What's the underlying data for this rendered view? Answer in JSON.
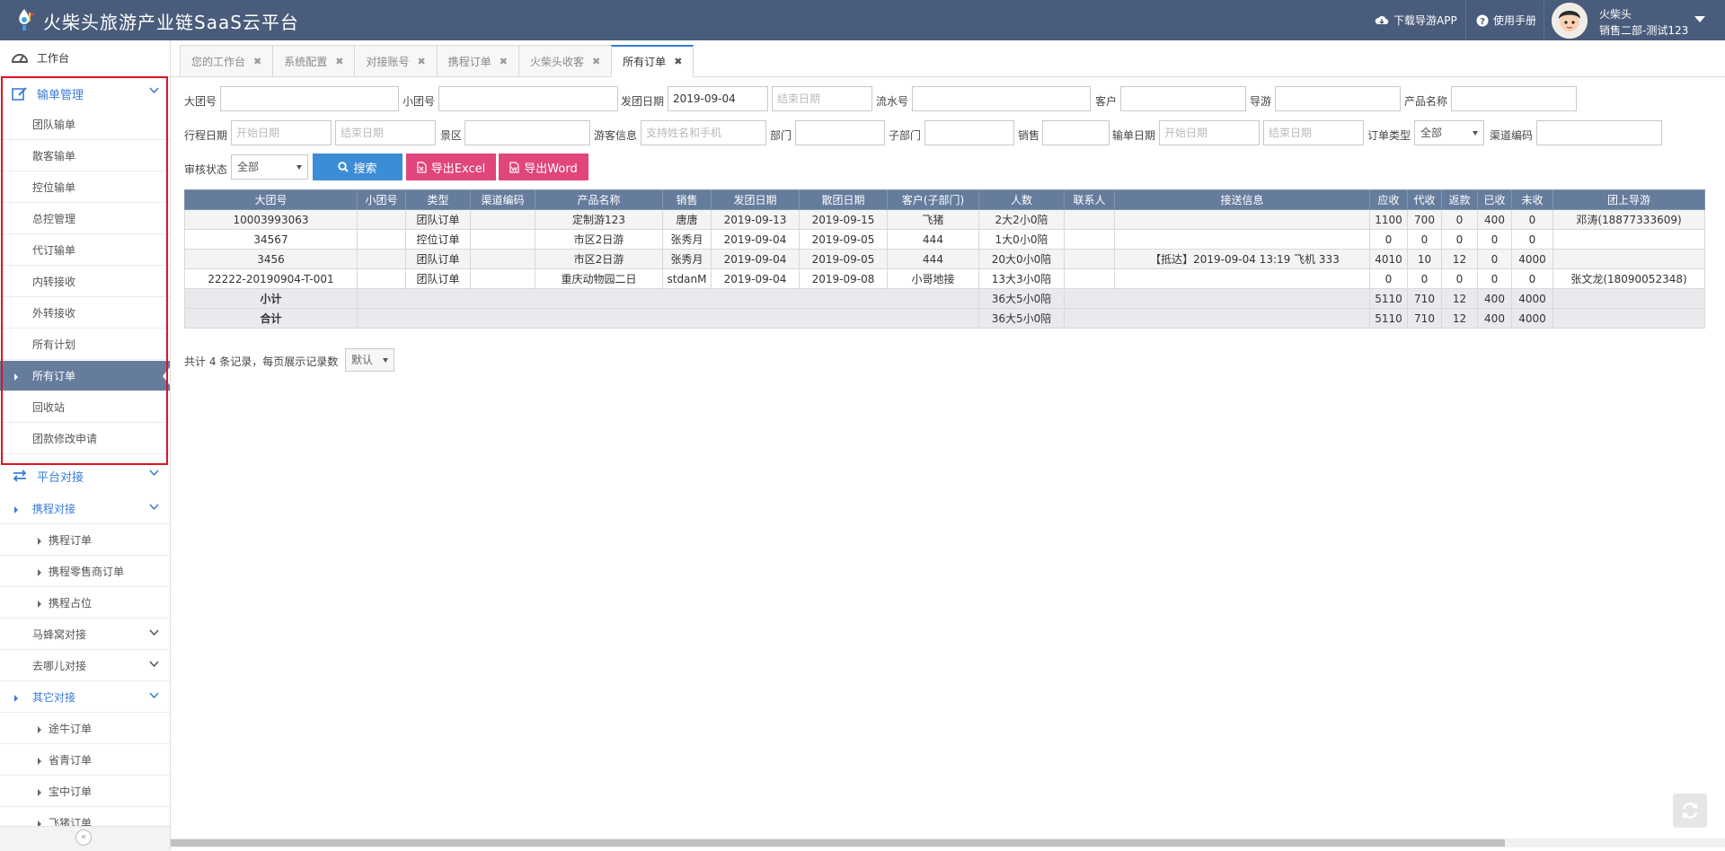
{
  "header": {
    "title": "火柴头旅游产业链SaaS云平台",
    "download_app": "下载导游APP",
    "manual": "使用手册",
    "user_name": "火柴头",
    "user_dept": "销售二部-测试123"
  },
  "sidebar": {
    "home": "工作台",
    "group1": "输单管理",
    "group1_items": [
      "团队输单",
      "散客输单",
      "控位输单",
      "总控管理",
      "代订输单",
      "内转接收",
      "外转接收",
      "所有计划",
      "所有订单",
      "回收站",
      "团款修改申请"
    ],
    "group2": "平台对接",
    "group2_items": [
      "携程对接",
      "携程订单",
      "携程零售商订单",
      "携程占位",
      "马蜂窝对接",
      "去哪儿对接",
      "其它对接",
      "途牛订单",
      "省青订单",
      "宝中订单",
      "飞猪订单"
    ]
  },
  "tabs": [
    {
      "label": "您的工作台"
    },
    {
      "label": "系统配置"
    },
    {
      "label": "对接账号"
    },
    {
      "label": "携程订单"
    },
    {
      "label": "火柴头收客"
    },
    {
      "label": "所有订单"
    }
  ],
  "filters": {
    "big_group": "大团号",
    "small_group": "小团号",
    "depart_date": "发团日期",
    "depart_date_value": "2019-09-04",
    "end_date_ph": "结束日期",
    "start_date_ph": "开始日期",
    "serial": "流水号",
    "customer": "客户",
    "guide": "导游",
    "product": "产品名称",
    "trip_date": "行程日期",
    "scenic": "景区",
    "tourist": "游客信息",
    "tourist_ph": "支持姓名和手机",
    "dept": "部门",
    "sub_dept": "子部门",
    "sales": "销售",
    "input_date": "输单日期",
    "order_type": "订单类型",
    "order_type_value": "全部",
    "channel": "渠道编码",
    "audit": "审核状态",
    "audit_value": "全部",
    "search_btn": "搜索",
    "excel_btn": "导出Excel",
    "word_btn": "导出Word"
  },
  "table": {
    "headers": [
      "大团号",
      "小团号",
      "类型",
      "渠道编码",
      "产品名称",
      "销售",
      "发团日期",
      "散团日期",
      "客户(子部门)",
      "人数",
      "联系人",
      "接送信息",
      "应收",
      "代收",
      "返款",
      "已收",
      "未收",
      "团上导游"
    ],
    "rows": [
      [
        "10003993063",
        "",
        "团队订单",
        "",
        "定制游123",
        "唐唐",
        "2019-09-13",
        "2019-09-15",
        "飞猪",
        "2大2小0陪",
        "",
        "",
        "1100",
        "700",
        "0",
        "400",
        "0",
        "邓涛(18877333609)"
      ],
      [
        "34567",
        "",
        "控位订单",
        "",
        "市区2日游",
        "张秀月",
        "2019-09-04",
        "2019-09-05",
        "444",
        "1大0小0陪",
        "",
        "",
        "0",
        "0",
        "0",
        "0",
        "0",
        ""
      ],
      [
        "3456",
        "",
        "团队订单",
        "",
        "市区2日游",
        "张秀月",
        "2019-09-04",
        "2019-09-05",
        "444",
        "20大0小0陪",
        "",
        "【抵达】2019-09-04 13:19 飞机 333",
        "4010",
        "10",
        "12",
        "0",
        "4000",
        ""
      ],
      [
        "22222-20190904-T-001",
        "",
        "团队订单",
        "",
        "重庆动物园二日",
        "stdanM",
        "2019-09-04",
        "2019-09-08",
        "小哥地接",
        "13大3小0陪",
        "",
        "",
        "0",
        "0",
        "0",
        "0",
        "0",
        "张文龙(18090052348)"
      ]
    ],
    "subtotal": {
      "label": "小计",
      "people": "36大5小0陪",
      "values": [
        "5110",
        "710",
        "12",
        "400",
        "4000"
      ]
    },
    "total": {
      "label": "合计",
      "people": "36大5小0陪",
      "values": [
        "5110",
        "710",
        "12",
        "400",
        "4000"
      ]
    }
  },
  "pager": {
    "text": "共计 4 条记录，每页展示记录数",
    "select": "默认"
  },
  "colors": {
    "header_bg": "#4a5c7b",
    "table_head": "#667c9d",
    "accent": "#3a7cd4",
    "export": "#e0457b",
    "highlight": "#e0141e"
  }
}
